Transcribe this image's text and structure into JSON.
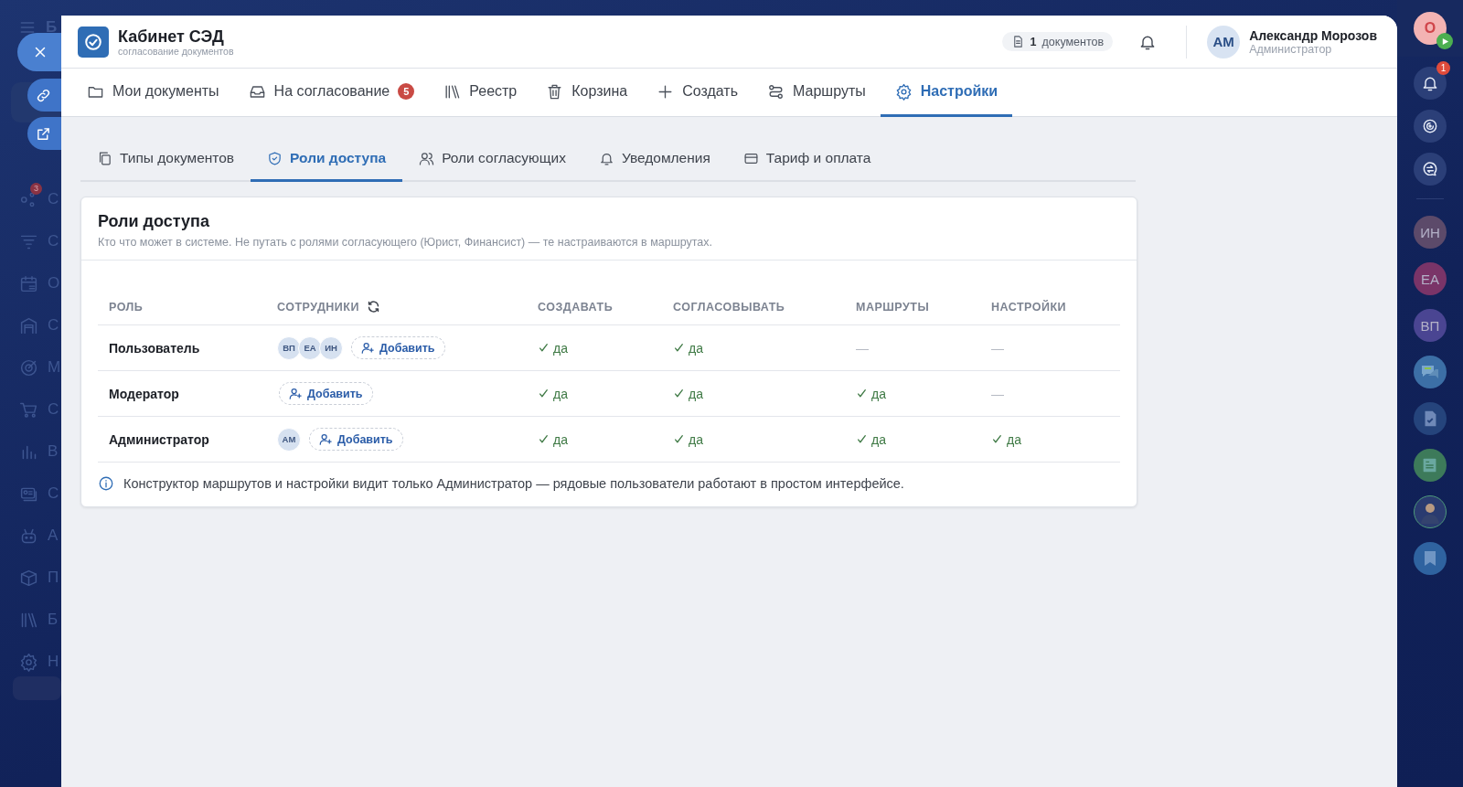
{
  "left_sidebar": {
    "title": "Б",
    "items": [
      {
        "label": "С",
        "badge": "3"
      },
      {
        "label": "С"
      },
      {
        "label": "О"
      },
      {
        "label": "С"
      },
      {
        "label": "М"
      },
      {
        "label": "С"
      },
      {
        "label": "В"
      },
      {
        "label": "С"
      },
      {
        "label": "А"
      },
      {
        "label": "П"
      },
      {
        "label": "Б"
      },
      {
        "label": "Н"
      }
    ]
  },
  "window": {
    "title": "Кабинет СЭД",
    "subtitle": "согласование документов",
    "documents": {
      "count": "1",
      "label": "документов"
    },
    "user": {
      "initials": "АМ",
      "name": "Александр Морозов",
      "role": "Администратор"
    }
  },
  "nav_tabs": [
    {
      "label": "Мои документы",
      "selected": false
    },
    {
      "label": "На согласование",
      "selected": false,
      "badge": "5"
    },
    {
      "label": "Реестр",
      "selected": false
    },
    {
      "label": "Корзина",
      "selected": false
    },
    {
      "label": "Создать",
      "selected": false
    },
    {
      "label": "Маршруты",
      "selected": false
    },
    {
      "label": "Настройки",
      "selected": true
    }
  ],
  "sub_tabs": [
    {
      "label": "Типы документов",
      "selected": false
    },
    {
      "label": "Роли доступа",
      "selected": true
    },
    {
      "label": "Роли согласующих",
      "selected": false
    },
    {
      "label": "Уведомления",
      "selected": false
    },
    {
      "label": "Тариф и оплата",
      "selected": false
    }
  ],
  "card": {
    "title": "Роли доступа",
    "subtitle": "Кто что может в системе. Не путать с ролями согласующего (Юрист, Финансист) — те настраиваются в маршрутах.",
    "table": {
      "columns": [
        "РОЛЬ",
        "СОТРУДНИКИ",
        "СОЗДАВАТЬ",
        "СОГЛАСОВЫВАТЬ",
        "МАРШРУТЫ",
        "НАСТРОЙКИ"
      ],
      "rows": [
        {
          "role": "Пользователь",
          "members": [
            "ВП",
            "ЕА",
            "ИН"
          ],
          "add_label": "Добавить",
          "permissions": [
            {
              "text": "да",
              "allowed": true
            },
            {
              "text": "да",
              "allowed": true
            },
            {
              "text": "—",
              "allowed": false
            },
            {
              "text": "—",
              "allowed": false
            }
          ]
        },
        {
          "role": "Модератор",
          "members": [],
          "add_label": "Добавить",
          "permissions": [
            {
              "text": "да",
              "allowed": true
            },
            {
              "text": "да",
              "allowed": true
            },
            {
              "text": "да",
              "allowed": true
            },
            {
              "text": "—",
              "allowed": false
            }
          ]
        },
        {
          "role": "Администратор",
          "members": [
            "АМ"
          ],
          "add_label": "Добавить",
          "permissions": [
            {
              "text": "да",
              "allowed": true
            },
            {
              "text": "да",
              "allowed": true
            },
            {
              "text": "да",
              "allowed": true
            },
            {
              "text": "да",
              "allowed": true
            }
          ]
        }
      ]
    },
    "note": "Конструктор маршрутов и настройки видит только Администратор — рядовые пользователи работают в простом интерфейсе."
  },
  "right_bar": {
    "profile": {
      "initial": "О"
    },
    "notifications_badge": "1",
    "contacts": [
      {
        "initials": "ИН",
        "color": "#5c4a6a"
      },
      {
        "initials": "ЕА",
        "color": "#7a3468"
      },
      {
        "initials": "ВП",
        "color": "#4a4592"
      }
    ]
  }
}
